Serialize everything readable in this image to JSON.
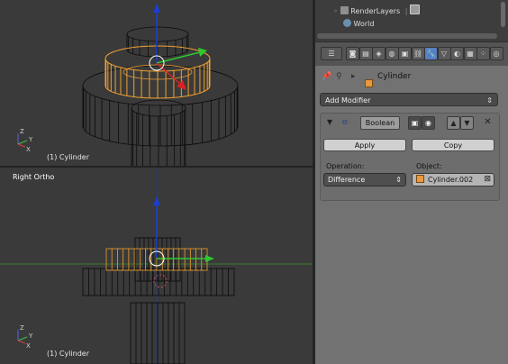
{
  "viewport_top": {
    "object_label": "(1) Cylinder"
  },
  "viewport_bottom": {
    "view_label": "Right Ortho",
    "object_label": "(1) Cylinder"
  },
  "axis_labels": {
    "x": "X",
    "y": "Y",
    "z": "Z"
  },
  "outliner": {
    "items": [
      {
        "label": "RenderLayers",
        "icon": "render-layers-icon"
      },
      {
        "label": "World",
        "icon": "world-icon"
      }
    ]
  },
  "properties": {
    "context_icons": [
      "render-icon",
      "render-layers-icon",
      "scene-icon",
      "world-icon",
      "object-icon",
      "constraints-icon",
      "modifier-icon",
      "data-icon",
      "material-icon",
      "texture-icon",
      "particles-icon",
      "physics-icon"
    ],
    "active_context": "modifier-icon",
    "breadcrumb": {
      "object_name": "Cylinder"
    },
    "add_modifier_label": "Add Modifier",
    "modifier": {
      "name": "Boolean",
      "apply_label": "Apply",
      "copy_label": "Copy",
      "operation_label": "Operation:",
      "operation_value": "Difference",
      "object_label": "Object:",
      "object_value": "Cylinder.002"
    }
  },
  "colors": {
    "viewport_bg": "#3a3a3a",
    "wire": "#0b0b0b",
    "selected_wire": "#f0a030",
    "x_axis": "#7a1f1f",
    "y_axis": "#3a7a2a",
    "gizmo_z": "#1a3fd0",
    "gizmo_y": "#2ec82e",
    "gizmo_x": "#e02020",
    "panel_bg": "#727272",
    "active_tab": "#5680c2"
  }
}
